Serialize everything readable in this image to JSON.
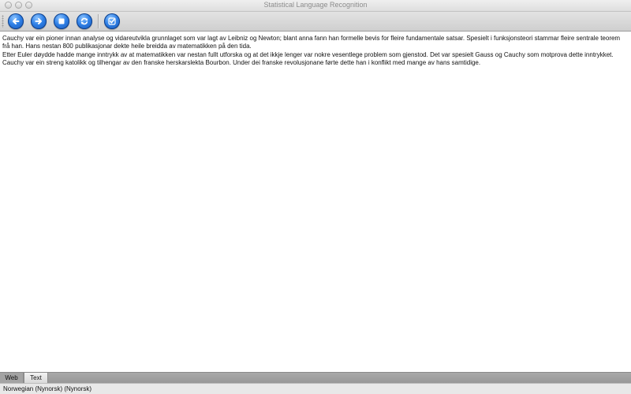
{
  "window": {
    "title": "Statistical Language Recognition"
  },
  "toolbar": {
    "buttons": [
      {
        "icon": "back-arrow-icon"
      },
      {
        "icon": "forward-arrow-icon"
      },
      {
        "icon": "stop-icon"
      },
      {
        "icon": "reload-icon"
      },
      {
        "icon": "check-icon"
      }
    ],
    "accent_color": "#2f80e6"
  },
  "content": {
    "paragraphs": [
      "Cauchy var ein pioner innan analyse og vidareutvikla grunnlaget som var lagt av Leibniz og Newton; blant anna fann han formelle bevis for fleire fundamentale satsar. Spesielt i funksjonsteori stammar fleire sentrale teorem frå han. Hans nestan 800 publikasjonar dekte heile breidda av matematikken på den tida.",
      "Etter Euler døydde hadde mange inntrykk av at matematikken var nestan fullt utforska og at det ikkje lenger var nokre vesentlege problem som gjenstod. Det var spesielt Gauss og Cauchy som motprova dette inntrykket.",
      "Cauchy var ein streng katolikk og tilhengar av den franske herskarslekta Bourbon. Under dei franske revolusjonane førte dette han i konflikt med mange av hans samtidige."
    ]
  },
  "tabs": {
    "web_label": "Web",
    "text_label": "Text",
    "selected": "Text"
  },
  "status": {
    "text": "Norwegian (Nynorsk) (Nynorsk)"
  }
}
